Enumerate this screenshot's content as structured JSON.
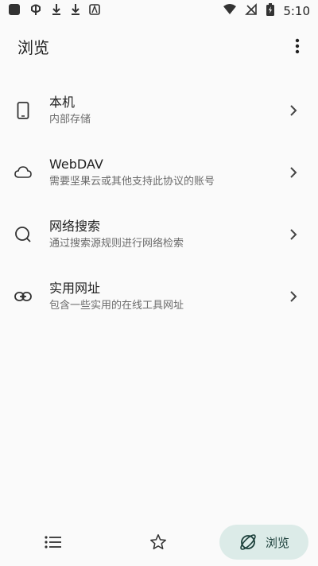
{
  "status_bar": {
    "time": "5:10",
    "left_icons": [
      "app-icon",
      "notification-icon",
      "download-icon",
      "download-icon",
      "app-a-icon"
    ],
    "right_icons": [
      "wifi-icon",
      "no-sim-icon",
      "battery-icon"
    ]
  },
  "app_bar": {
    "title": "浏览",
    "menu_icon": "more-vert-icon"
  },
  "list": [
    {
      "icon": "phone-icon",
      "title": "本机",
      "subtitle": "内部存储"
    },
    {
      "icon": "cloud-icon",
      "title": "WebDAV",
      "subtitle": "需要坚果云或其他支持此协议的账号"
    },
    {
      "icon": "search-icon",
      "title": "网络搜索",
      "subtitle": "通过搜索源规则进行网络检索"
    },
    {
      "icon": "link-icon",
      "title": "实用网址",
      "subtitle": "包含一些实用的在线工具网址"
    }
  ],
  "bottom_nav": {
    "items": [
      {
        "icon": "list-icon"
      },
      {
        "icon": "star-icon"
      },
      {
        "icon": "browse-icon",
        "label": "浏览",
        "active": true
      }
    ],
    "active_color": "#dcebe8"
  }
}
